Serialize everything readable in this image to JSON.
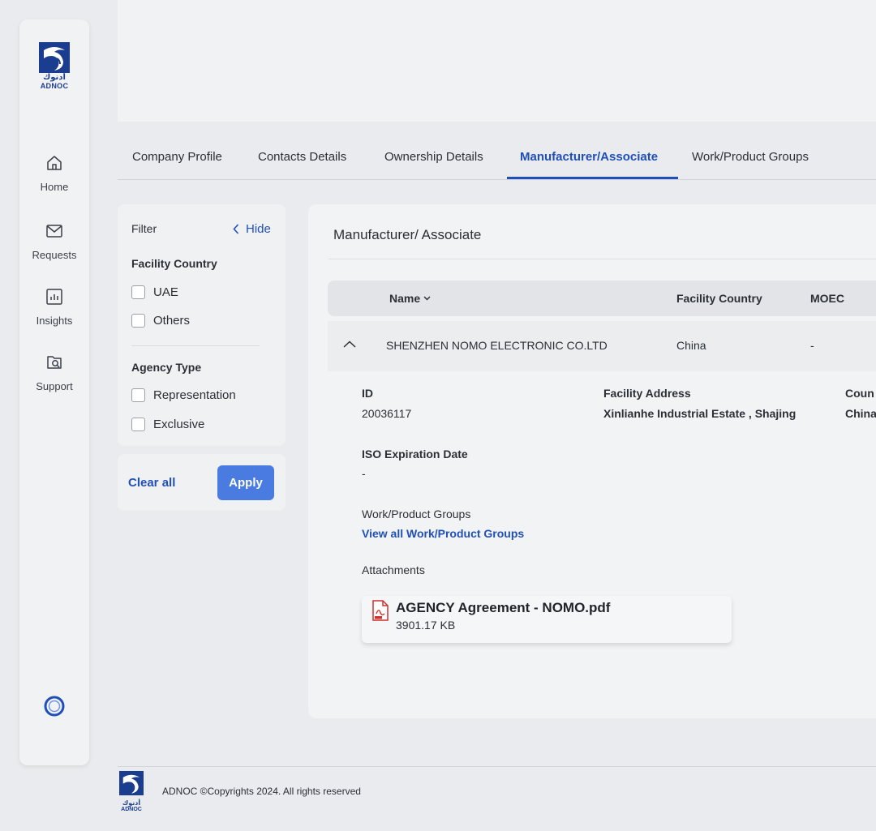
{
  "brand": {
    "logo_arabic": "أدنوك",
    "logo_english": "ADNOC",
    "primary_color": "#1f4fb7",
    "button_color": "#4a7be0"
  },
  "sidebar": {
    "items": [
      {
        "label": "Home",
        "icon": "home-icon"
      },
      {
        "label": "Requests",
        "icon": "mail-icon"
      },
      {
        "label": "Insights",
        "icon": "chart-icon"
      },
      {
        "label": "Support",
        "icon": "support-icon"
      }
    ]
  },
  "tabs": [
    {
      "label": "Company Profile"
    },
    {
      "label": "Contacts Details"
    },
    {
      "label": "Ownership Details"
    },
    {
      "label": "Manufacturer/Associate",
      "active": true
    },
    {
      "label": "Work/Product Groups"
    }
  ],
  "filter": {
    "title": "Filter",
    "hide_label": "Hide",
    "facility_country": {
      "heading": "Facility Country",
      "options": [
        "UAE",
        "Others"
      ]
    },
    "agency_type": {
      "heading": "Agency Type",
      "options": [
        "Representation",
        "Exclusive"
      ]
    },
    "clear_all_label": "Clear all",
    "apply_label": "Apply"
  },
  "main": {
    "title": "Manufacturer/ Associate",
    "columns": {
      "name": "Name",
      "facility_country": "Facility Country",
      "moec": "MOEC"
    },
    "row": {
      "name": "SHENZHEN NOMO ELECTRONIC CO.LTD",
      "facility_country": "China",
      "moec": "-"
    },
    "detail": {
      "id_label": "ID",
      "id_value": "20036117",
      "address_label": "Facility Address",
      "address_value": "Xinlianhe Industrial Estate , Shajing",
      "country_label": "Coun",
      "country_value": "China",
      "iso_label": "ISO Expiration Date",
      "iso_value": "-",
      "groups_label": "Work/Product Groups",
      "groups_link": "View all Work/Product Groups",
      "attachments_label": "Attachments",
      "attachment": {
        "file_name": "AGENCY Agreement - NOMO.pdf",
        "file_size": "3901.17 KB",
        "icon": "pdf-icon"
      }
    }
  },
  "footer": {
    "copyright": "ADNOC ©Copyrights 2024. All rights reserved"
  }
}
